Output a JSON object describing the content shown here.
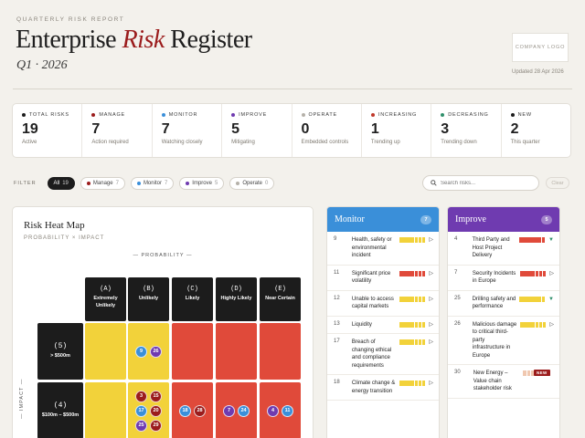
{
  "header": {
    "kicker": "QUARTERLY RISK REPORT",
    "title_main": "Enterprise ",
    "title_accent": "Risk",
    "title_end": " Register",
    "subtitle": "Q1 · 2026",
    "logo": "COMPANY LOGO",
    "updated": "Updated 28 Apr 2026"
  },
  "stats": [
    {
      "label": "TOTAL RISKS",
      "value": "19",
      "sub": "Active",
      "color": "#1c1c1c"
    },
    {
      "label": "MANAGE",
      "value": "7",
      "sub": "Action required",
      "color": "#9b1c1c"
    },
    {
      "label": "MONITOR",
      "value": "7",
      "sub": "Watching closely",
      "color": "#3a8fd9"
    },
    {
      "label": "IMPROVE",
      "value": "5",
      "sub": "Mitigating",
      "color": "#6f3bb0"
    },
    {
      "label": "OPERATE",
      "value": "0",
      "sub": "Embedded controls",
      "color": "#b5b1a9"
    },
    {
      "label": "INCREASING",
      "value": "1",
      "sub": "Trending up",
      "color": "#c0392b"
    },
    {
      "label": "DECREASING",
      "value": "3",
      "sub": "Trending down",
      "color": "#2f8f6a"
    },
    {
      "label": "NEW",
      "value": "2",
      "sub": "This quarter",
      "color": "#1c1c1c"
    }
  ],
  "filters": {
    "label": "FILTER",
    "chips": [
      {
        "label": "All",
        "count": "19",
        "color": ""
      },
      {
        "label": "Manage",
        "count": "7",
        "color": "#9b1c1c"
      },
      {
        "label": "Monitor",
        "count": "7",
        "color": "#3a8fd9"
      },
      {
        "label": "Improve",
        "count": "5",
        "color": "#6f3bb0"
      },
      {
        "label": "Operate",
        "count": "0",
        "color": "#b5b1a9"
      }
    ],
    "search_placeholder": "Search risks...",
    "search_value": "",
    "clear": "Clear"
  },
  "heatmap": {
    "title": "Risk Heat Map",
    "subtitle": "PROBABILITY × IMPACT",
    "prob_label": "— PROBABILITY —",
    "impact_label": "— IMPACT —",
    "columns": [
      {
        "code": "(A)",
        "name": "Extremely Unlikely"
      },
      {
        "code": "(B)",
        "name": "Unlikely"
      },
      {
        "code": "(C)",
        "name": "Likely"
      },
      {
        "code": "(D)",
        "name": "Highly Likely"
      },
      {
        "code": "(E)",
        "name": "Near Certain"
      }
    ],
    "rows": [
      {
        "code": "(5)",
        "name": "> $500m",
        "cells": [
          {
            "color": "#f2d23a",
            "risks": []
          },
          {
            "color": "#f2d23a",
            "risks": [
              {
                "id": "9",
                "c": "#3a8fd9"
              },
              {
                "id": "26",
                "c": "#6f3bb0"
              }
            ]
          },
          {
            "color": "#e04a3a",
            "risks": []
          },
          {
            "color": "#e04a3a",
            "risks": []
          },
          {
            "color": "#e04a3a",
            "risks": []
          }
        ]
      },
      {
        "code": "(4)",
        "name": "$100m – $500m",
        "cells": [
          {
            "color": "#f2d23a",
            "risks": []
          },
          {
            "color": "#f2d23a",
            "risks": [
              {
                "id": "3",
                "c": "#9b1c1c"
              },
              {
                "id": "15",
                "c": "#9b1c1c"
              },
              {
                "id": "17",
                "c": "#3a8fd9"
              },
              {
                "id": "20",
                "c": "#9b1c1c"
              },
              {
                "id": "25",
                "c": "#6f3bb0"
              },
              {
                "id": "29",
                "c": "#9b1c1c"
              }
            ]
          },
          {
            "color": "#e04a3a",
            "risks": [
              {
                "id": "18",
                "c": "#3a8fd9"
              },
              {
                "id": "28",
                "c": "#9b1c1c"
              }
            ]
          },
          {
            "color": "#e04a3a",
            "risks": [
              {
                "id": "7",
                "c": "#6f3bb0"
              },
              {
                "id": "24",
                "c": "#3a8fd9"
              }
            ]
          },
          {
            "color": "#e04a3a",
            "risks": [
              {
                "id": "4",
                "c": "#6f3bb0"
              },
              {
                "id": "11",
                "c": "#3a8fd9"
              }
            ]
          }
        ]
      }
    ]
  },
  "columns": [
    {
      "title": "Monitor",
      "count": "7",
      "color": "#3a8fd9",
      "items": [
        {
          "id": "9",
          "text": "Health, safety or environmental incident",
          "bar": [
            "#f2d23a",
            "#f2d23a",
            "#f2d23a",
            "#f2d23a",
            "#f2d23a",
            "#f2d23a",
            "#f2d23a"
          ],
          "arrow": "▷",
          "arrow_color": "#333",
          "badge": ""
        },
        {
          "id": "11",
          "text": "Significant price volatility",
          "bar": [
            "#e04a3a",
            "#e04a3a",
            "#e04a3a",
            "#e04a3a",
            "#e04a3a",
            "#e04a3a",
            "#e04a3a"
          ],
          "arrow": "▷",
          "arrow_color": "#333",
          "badge": ""
        },
        {
          "id": "12",
          "text": "Unable to access capital markets",
          "bar": [
            "#f2d23a",
            "#f2d23a",
            "#f2d23a",
            "#f2d23a",
            "#f2d23a",
            "#f2d23a",
            "#f2d23a"
          ],
          "arrow": "▷",
          "arrow_color": "#333",
          "badge": ""
        },
        {
          "id": "13",
          "text": "Liquidity",
          "bar": [
            "#f2d23a",
            "#f2d23a",
            "#f2d23a",
            "#f2d23a",
            "#f2d23a",
            "#f2d23a",
            "#f2d23a"
          ],
          "arrow": "▷",
          "arrow_color": "#333",
          "badge": ""
        },
        {
          "id": "17",
          "text": "Breach of changing ethical and compliance requirements",
          "bar": [
            "#f2d23a",
            "#f2d23a",
            "#f2d23a",
            "#f2d23a",
            "#f2d23a",
            "#f2d23a",
            "#f2d23a"
          ],
          "arrow": "▷",
          "arrow_color": "#333",
          "badge": ""
        },
        {
          "id": "18",
          "text": "Climate change & energy transition",
          "bar": [
            "#f2d23a",
            "#f2d23a",
            "#f2d23a",
            "#f2d23a",
            "#f2d23a",
            "#f2d23a",
            "#f2d23a"
          ],
          "arrow": "▷",
          "arrow_color": "#333",
          "badge": ""
        }
      ]
    },
    {
      "title": "Improve",
      "count": "5",
      "color": "#6f3bb0",
      "items": [
        {
          "id": "4",
          "text": "Third Party and Host Project Delivery",
          "bar": [
            "#e04a3a",
            "#e04a3a",
            "#e04a3a",
            "#e04a3a",
            "#e04a3a",
            "#e04a3a",
            "#e04a3a"
          ],
          "arrow": "▼",
          "arrow_color": "#2f8f6a",
          "badge": ""
        },
        {
          "id": "7",
          "text": "Security Incidents in Europe",
          "bar": [
            "#e04a3a",
            "#e04a3a",
            "#e04a3a",
            "#e04a3a",
            "#e04a3a",
            "#e04a3a",
            "#e04a3a"
          ],
          "arrow": "▷",
          "arrow_color": "#333",
          "badge": ""
        },
        {
          "id": "25",
          "text": "Drilling safety and performance",
          "bar": [
            "#f2d23a",
            "#f2d23a",
            "#f2d23a",
            "#f2d23a",
            "#f2d23a",
            "#f2d23a",
            "#f2d23a"
          ],
          "arrow": "▼",
          "arrow_color": "#2f8f6a",
          "badge": ""
        },
        {
          "id": "26",
          "text": "Malicious damage to critical third-party infrastructure in Europe",
          "bar": [
            "#f2d23a",
            "#f2d23a",
            "#f2d23a",
            "#f2d23a",
            "#f2d23a",
            "#f2d23a",
            "#f2d23a"
          ],
          "arrow": "▷",
          "arrow_color": "#333",
          "badge": ""
        },
        {
          "id": "30",
          "text": "New Energy – Value chain stakeholder risk",
          "bar": [
            "#f0c8b0",
            "#f0c8b0",
            "#f0c8b0",
            "#f0c8b0",
            "#f0c8b0",
            "#f0c8b0",
            "#9a9a9a"
          ],
          "arrow": "",
          "arrow_color": "#333",
          "badge": "NEW"
        }
      ]
    }
  ]
}
